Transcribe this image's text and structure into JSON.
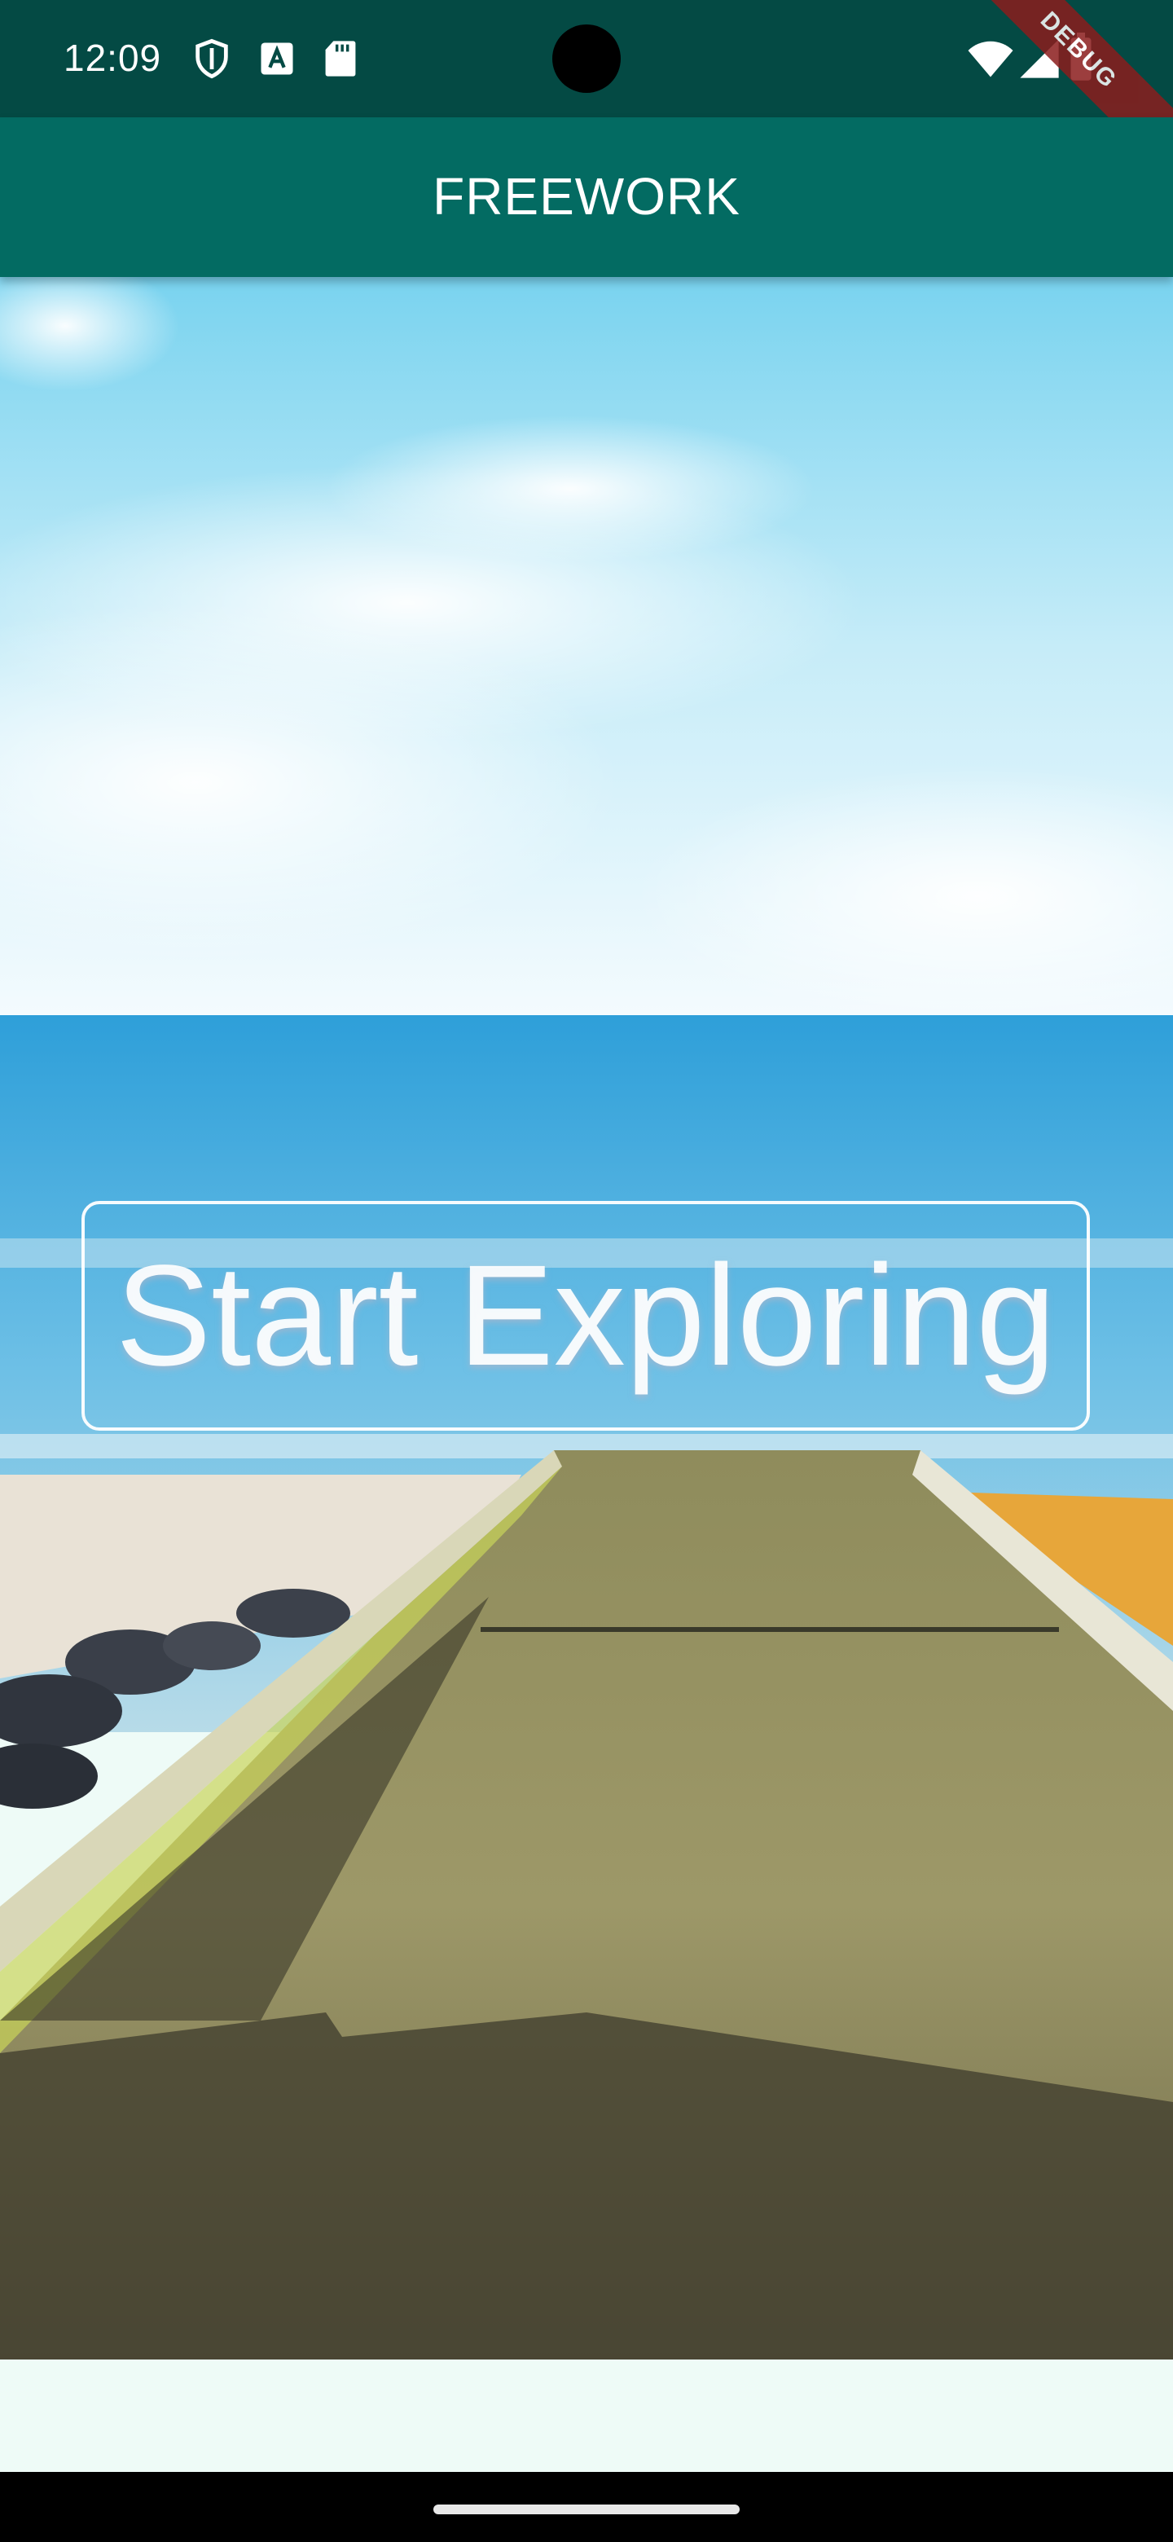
{
  "status_bar": {
    "time": "12:09",
    "left_icons": [
      "shield-icon",
      "text-a-icon",
      "sd-card-icon"
    ],
    "right_icons": [
      "wifi-icon",
      "signal-icon",
      "battery-icon"
    ]
  },
  "debug_banner": "DEBUG",
  "app_bar": {
    "title": "FREEWORK"
  },
  "hero": {
    "description": "beach boat ramp background image",
    "cta_label": "Start Exploring"
  },
  "colors": {
    "status_bar": "#044a44",
    "app_bar": "#036b62",
    "page_background": "#eefbf7",
    "nav_bar": "#000000"
  }
}
